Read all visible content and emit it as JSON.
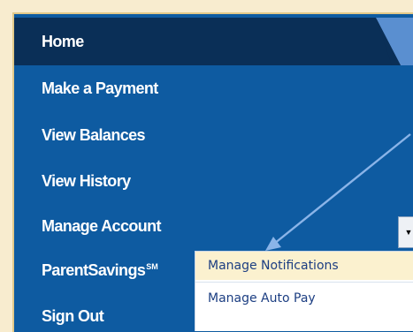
{
  "nav": {
    "items": [
      {
        "label": "Home"
      },
      {
        "label": "Make a Payment"
      },
      {
        "label": "View Balances"
      },
      {
        "label": "View History"
      },
      {
        "label": "Manage Account"
      },
      {
        "label": "ParentSavings",
        "superscript": "SM"
      },
      {
        "label": "Sign Out"
      }
    ]
  },
  "submenu": {
    "items": [
      {
        "label": "Manage Notifications",
        "highlighted": true
      },
      {
        "label": "Manage Auto Pay"
      }
    ]
  },
  "colors": {
    "background": "#f8eccf",
    "nav_blue": "#0e5ba1",
    "nav_active": "#0a2f57",
    "submenu_highlight": "#fbf1cf",
    "submenu_text": "#1c3e82",
    "annotation_arrow": "#8ab4e8"
  },
  "icons": {
    "dropdown": "caret-down-icon",
    "annotation": "pointer-arrow-icon"
  }
}
